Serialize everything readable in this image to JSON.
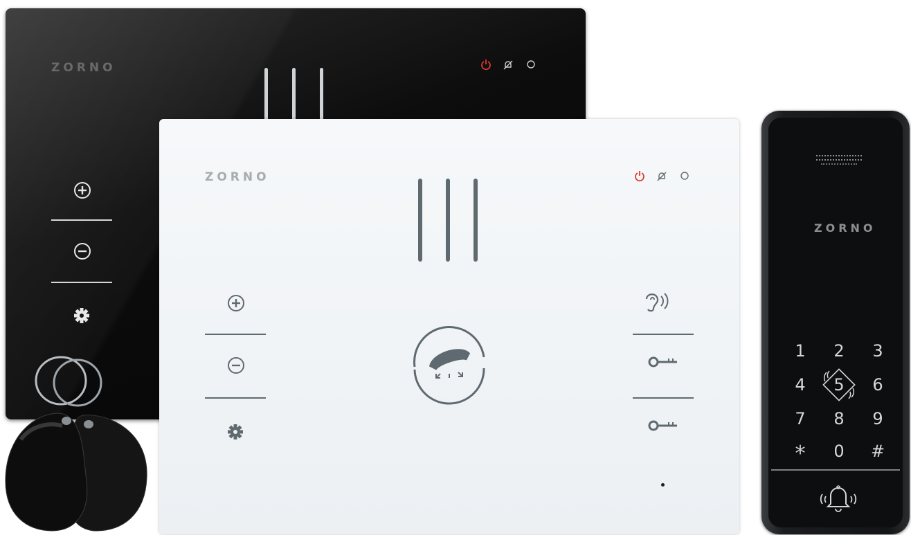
{
  "products": {
    "black_monitor": {
      "brand": "ZORNO",
      "indicators": [
        "power-icon",
        "mute-bell-icon",
        "circle-icon"
      ]
    },
    "white_monitor": {
      "brand": "ZORNO",
      "indicators": [
        "power-icon",
        "mute-bell-icon",
        "circle-icon"
      ],
      "left_controls": [
        "plus-icon",
        "minus-icon",
        "gear-icon"
      ],
      "right_controls": [
        "ear-listen-icon",
        "key-icon",
        "key-icon"
      ],
      "center_control": "handset-icon"
    },
    "keypad": {
      "brand": "ZORNO",
      "keys": [
        "1",
        "2",
        "3",
        "4",
        "5",
        "6",
        "7",
        "8",
        "9",
        "*",
        "0",
        "#"
      ],
      "bell": "bell-icon"
    }
  },
  "colors": {
    "power_red": "#e0392f",
    "icon_grey": "#5f6a70",
    "black_icon": "#e8e8e8"
  }
}
